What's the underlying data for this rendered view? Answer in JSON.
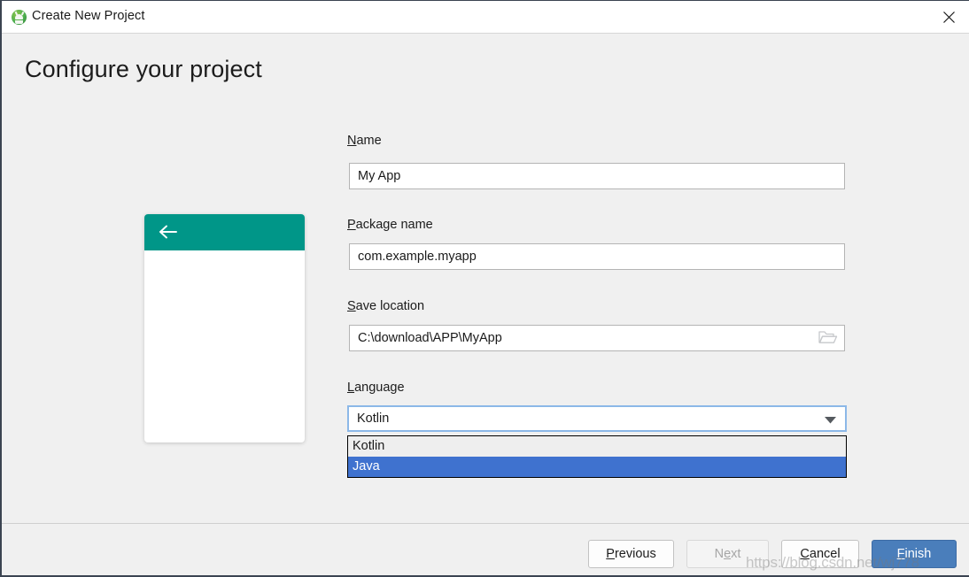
{
  "window": {
    "title": "Create New Project",
    "app_icon": "android-studio-icon",
    "close_icon": "close-icon"
  },
  "page": {
    "title": "Configure your project"
  },
  "preview": {
    "name": "phone-preview",
    "toolbar_color": "#009688",
    "back_icon": "back-arrow-icon"
  },
  "form": {
    "name": {
      "label_mnemonic": "N",
      "label_rest": "ame",
      "value": "My App",
      "placeholder": ""
    },
    "package_name": {
      "label_mnemonic": "P",
      "label_rest": "ackage name",
      "value": "com.example.myapp",
      "placeholder": ""
    },
    "save_location": {
      "label_mnemonic": "S",
      "label_rest": "ave location",
      "value": "C:\\download\\APP\\MyApp",
      "placeholder": "",
      "browse_icon": "folder-icon"
    },
    "language": {
      "label_mnemonic": "L",
      "label_rest": "anguage",
      "value": "Kotlin",
      "dropdown_icon": "chevron-down-icon",
      "expanded": true,
      "options": [
        {
          "label": "Kotlin",
          "selected": false
        },
        {
          "label": "Java",
          "selected": true
        }
      ]
    }
  },
  "footer": {
    "previous": {
      "mnemonic": "P",
      "rest": "revious",
      "pre": ""
    },
    "next": {
      "pre": "N",
      "mnemonic": "e",
      "rest": "xt"
    },
    "cancel": {
      "pre": "",
      "mnemonic": "C",
      "rest": "ancel"
    },
    "finish": {
      "pre": "",
      "mnemonic": "F",
      "rest": "inish"
    }
  },
  "watermark": {
    "text": "https://blog.csdn.net/wj778"
  },
  "colors": {
    "accent_teal": "#009688",
    "primary_blue": "#4a7ebb",
    "selection_blue": "#3f72cf",
    "focus_border": "#8cb8e8",
    "dialog_bg": "#f0f0f0"
  }
}
